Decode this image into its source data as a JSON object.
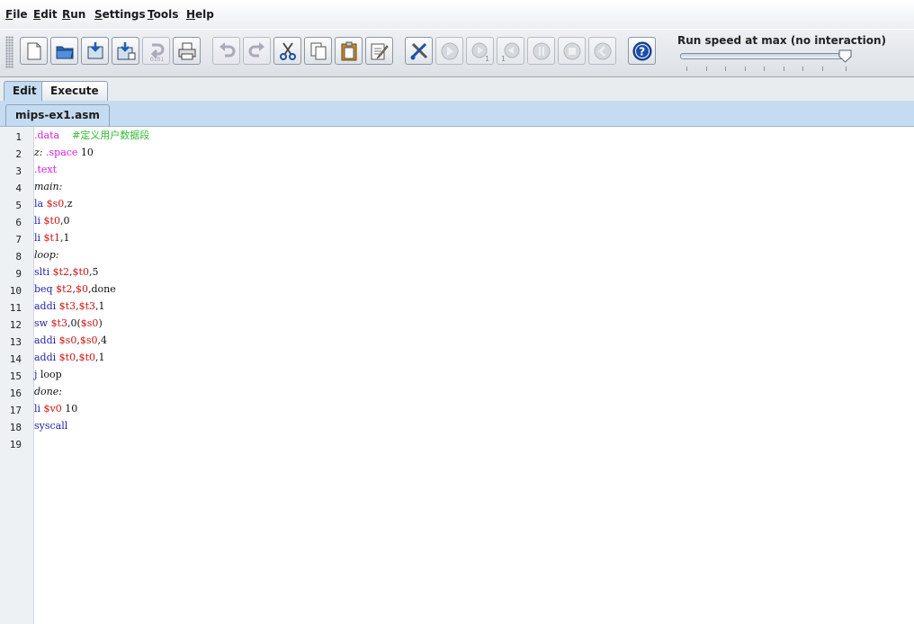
{
  "menu": {
    "items": [
      {
        "mnemonic": "F",
        "rest": "ile"
      },
      {
        "mnemonic": "E",
        "rest": "dit"
      },
      {
        "mnemonic": "R",
        "rest": "un"
      },
      {
        "mnemonic": "S",
        "rest": "ettings"
      },
      {
        "mnemonic": "T",
        "rest": "ools"
      },
      {
        "mnemonic": "H",
        "rest": "elp"
      }
    ]
  },
  "toolbar": {
    "run_speed_label": "Run speed at max (no interaction)",
    "run_speed_value_percent": 100,
    "step_badge": "1",
    "backstep_badge": "1",
    "dump_badge": "0101"
  },
  "tabs": [
    "Edit",
    "Execute"
  ],
  "active_tab": "Edit",
  "file_tab": "mips-ex1.asm",
  "editor": {
    "line_numbers": [
      "1",
      "2",
      "3",
      "4",
      "5",
      "6",
      "7",
      "8",
      "9",
      "10",
      "11",
      "12",
      "13",
      "14",
      "15",
      "16",
      "17",
      "18",
      "19"
    ],
    "lines": [
      [
        {
          "t": ".data",
          "c": "directive"
        },
        {
          "t": "    ",
          "c": "plain"
        },
        {
          "t": "#定义用户数据段",
          "c": "comment"
        }
      ],
      [
        {
          "t": "z:",
          "c": "label"
        },
        {
          "t": " ",
          "c": "plain"
        },
        {
          "t": ".space",
          "c": "directive"
        },
        {
          "t": " 10",
          "c": "plain"
        }
      ],
      [
        {
          "t": ".text",
          "c": "directive"
        }
      ],
      [
        {
          "t": "main:",
          "c": "label"
        }
      ],
      [
        {
          "t": "la",
          "c": "instr"
        },
        {
          "t": " ",
          "c": "plain"
        },
        {
          "t": "$s0",
          "c": "reg"
        },
        {
          "t": ",z",
          "c": "plain"
        }
      ],
      [
        {
          "t": "li",
          "c": "instr"
        },
        {
          "t": " ",
          "c": "plain"
        },
        {
          "t": "$t0",
          "c": "reg"
        },
        {
          "t": ",0",
          "c": "plain"
        }
      ],
      [
        {
          "t": "li",
          "c": "instr"
        },
        {
          "t": " ",
          "c": "plain"
        },
        {
          "t": "$t1",
          "c": "reg"
        },
        {
          "t": ",1",
          "c": "plain"
        }
      ],
      [
        {
          "t": "loop:",
          "c": "label"
        }
      ],
      [
        {
          "t": "slti",
          "c": "instr"
        },
        {
          "t": " ",
          "c": "plain"
        },
        {
          "t": "$t2",
          "c": "reg"
        },
        {
          "t": ",",
          "c": "plain"
        },
        {
          "t": "$t0",
          "c": "reg"
        },
        {
          "t": ",5",
          "c": "plain"
        }
      ],
      [
        {
          "t": "beq",
          "c": "instr"
        },
        {
          "t": " ",
          "c": "plain"
        },
        {
          "t": "$t2",
          "c": "reg"
        },
        {
          "t": ",",
          "c": "plain"
        },
        {
          "t": "$0",
          "c": "reg"
        },
        {
          "t": ",done",
          "c": "plain"
        }
      ],
      [
        {
          "t": "addi",
          "c": "instr"
        },
        {
          "t": " ",
          "c": "plain"
        },
        {
          "t": "$t3",
          "c": "reg"
        },
        {
          "t": ",",
          "c": "plain"
        },
        {
          "t": "$t3",
          "c": "reg"
        },
        {
          "t": ",1",
          "c": "plain"
        }
      ],
      [
        {
          "t": "sw",
          "c": "instr"
        },
        {
          "t": " ",
          "c": "plain"
        },
        {
          "t": "$t3",
          "c": "reg"
        },
        {
          "t": ",0(",
          "c": "plain"
        },
        {
          "t": "$s0",
          "c": "reg"
        },
        {
          "t": ")",
          "c": "plain"
        }
      ],
      [
        {
          "t": "addi",
          "c": "instr"
        },
        {
          "t": " ",
          "c": "plain"
        },
        {
          "t": "$s0",
          "c": "reg"
        },
        {
          "t": ",",
          "c": "plain"
        },
        {
          "t": "$s0",
          "c": "reg"
        },
        {
          "t": ",4",
          "c": "plain"
        }
      ],
      [
        {
          "t": "addi",
          "c": "instr"
        },
        {
          "t": " ",
          "c": "plain"
        },
        {
          "t": "$t0",
          "c": "reg"
        },
        {
          "t": ",",
          "c": "plain"
        },
        {
          "t": "$t0",
          "c": "reg"
        },
        {
          "t": ",1",
          "c": "plain"
        }
      ],
      [
        {
          "t": "j",
          "c": "instr"
        },
        {
          "t": " loop",
          "c": "plain"
        }
      ],
      [
        {
          "t": "done:",
          "c": "label"
        }
      ],
      [
        {
          "t": "li",
          "c": "instr"
        },
        {
          "t": " ",
          "c": "plain"
        },
        {
          "t": "$v0",
          "c": "reg"
        },
        {
          "t": " 10",
          "c": "plain"
        }
      ],
      [
        {
          "t": "syscall",
          "c": "instr"
        }
      ],
      []
    ]
  }
}
